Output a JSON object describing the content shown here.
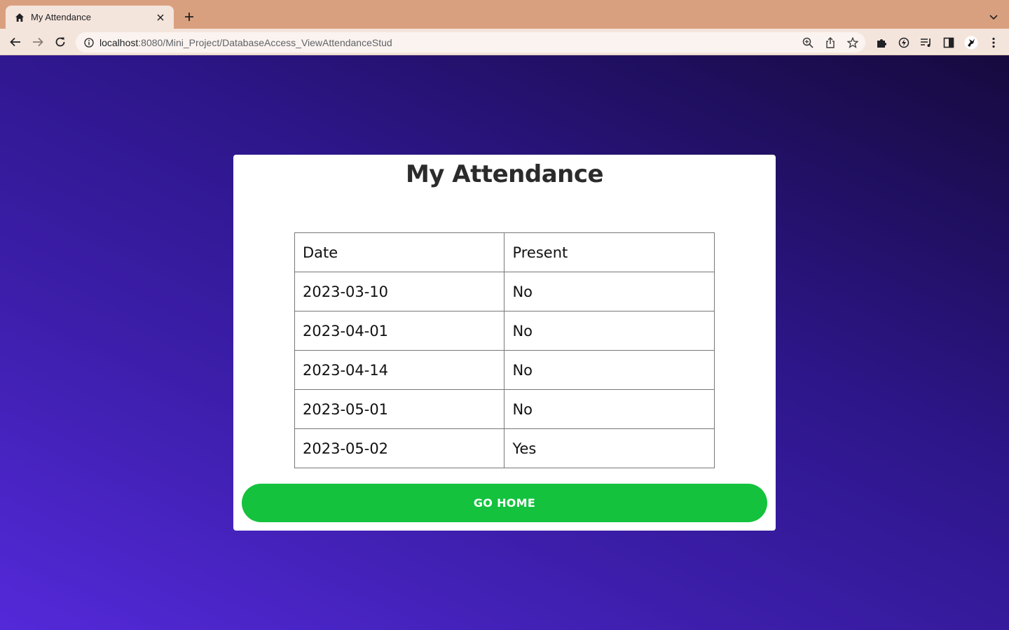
{
  "browser": {
    "tab_title": "My Attendance",
    "url_host": "localhost",
    "url_path": ":8080/Mini_Project/DatabaseAccess_ViewAttendanceStud",
    "colors": {
      "tabbar": "#d9a07f",
      "toolbar": "#f4e5dc"
    },
    "icons": [
      "home-icon",
      "close-icon",
      "plus-icon",
      "chevron-down-icon",
      "back-icon",
      "forward-icon",
      "reload-icon",
      "info-icon",
      "zoom-icon",
      "share-icon",
      "star-icon",
      "extensions-icon",
      "extension-icon",
      "media-icon",
      "sidepanel-icon",
      "profile-icon",
      "menu-icon"
    ]
  },
  "page": {
    "title": "My Attendance",
    "table": {
      "headers": [
        "Date",
        "Present"
      ],
      "rows": [
        [
          "2023-03-10",
          "No"
        ],
        [
          "2023-04-01",
          "No"
        ],
        [
          "2023-04-14",
          "No"
        ],
        [
          "2023-05-01",
          "No"
        ],
        [
          "2023-05-02",
          "Yes"
        ]
      ]
    },
    "button_label": "GO HOME",
    "colors": {
      "button": "#14c23d",
      "gradient_start": "#5429d9",
      "gradient_end": "#160a3e"
    }
  }
}
